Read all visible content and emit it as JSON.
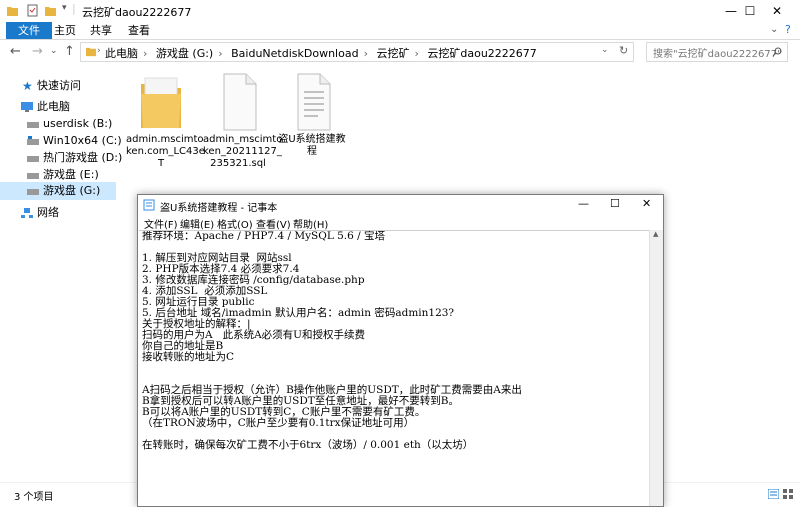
{
  "explorer": {
    "window_title": "云挖矿daou2222677",
    "window_controls": {
      "minimize": "—",
      "maximize": "☐",
      "close": "✕"
    },
    "ribbon": {
      "file": "文件",
      "home": "主页",
      "share": "共享",
      "view": "查看"
    },
    "address": {
      "crumbs": [
        "此电脑",
        "游戏盘 (G:)",
        "BaiduNetdiskDownload",
        "云挖矿",
        "云挖矿daou2222677"
      ],
      "search_placeholder": "搜索\"云挖矿daou2222677\""
    },
    "nav": {
      "quick_access": "快速访问",
      "this_pc": "此电脑",
      "drives": [
        "userdisk (B:)",
        "Win10x64 (C:)",
        "热门游戏盘 (D:)",
        "游戏盘 (E:)",
        "游戏盘 (G:)"
      ],
      "network": "网络"
    },
    "files": [
      {
        "name": "admin.mscimtoken.com_LC43eT",
        "display": "admin.mscimto\nken.com_LC43e\nT",
        "icon": "folder-icon"
      },
      {
        "name": "admin_mscimtoken_20211127_235321.sql",
        "display": "admin_mscimto\nken_20211127_\n235321.sql",
        "icon": "document-icon"
      },
      {
        "name": "盗U系统搭建教程",
        "display": "盗U系统搭建教程",
        "icon": "text-file-icon"
      }
    ],
    "status": "3 个项目"
  },
  "notepad": {
    "title": "盗U系统搭建教程 - 记事本",
    "menu": [
      "文件(F)",
      "编辑(E)",
      "格式(O)",
      "查看(V)",
      "帮助(H)"
    ],
    "lines": [
      "推荐环境：Apache / PHP7.4 / MySQL 5.6 / 宝塔",
      "",
      "1. 解压到对应网站目录  网站ssl",
      "2. PHP版本选择7.4 必须要求7.4",
      "3. 修改数据库连接密码 /config/database.php",
      "4. 添加SSL  必须添加SSL",
      "5. 网址运行目录 public",
      "5. 后台地址 域名/imadmin 默认用户名：admin 密码admin123?",
      "关于授权地址的解释：|",
      "扫码的用户为A   此系统A必须有U和授权手续费",
      "你自己的地址是B",
      "接收转账的地址为C",
      "",
      "",
      "A扫码之后相当于授权（允许）B操作他账户里的USDT，此时矿工费需要由A来出",
      "B拿到授权后可以转A账户里的USDT至任意地址，最好不要转到B。",
      "B可以将A账户里的USDT转到C，C账户里不需要有矿工费。",
      "（在TRON波场中，C账户至少要有0.1trx保证地址可用）",
      "",
      "在转账时，确保每次矿工费不小于6trx（波场）/ 0.001 eth（以太坊）"
    ]
  }
}
